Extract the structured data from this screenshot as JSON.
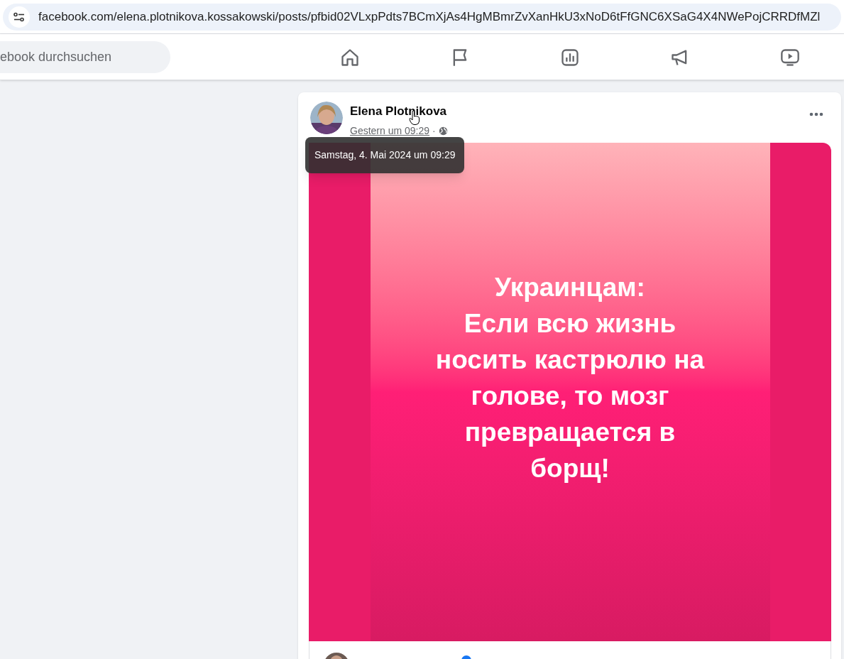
{
  "browser": {
    "url": "facebook.com/elena.plotnikova.kossakowski/posts/pfbid02VLxpPdts7BCmXjAs4HgMBmrZvXanHkU3xNoD6tFfGNC6XSaG4X4NWePojCRRDfMZl"
  },
  "top_bar": {
    "search": {
      "placeholder": "ebook durchsuchen"
    },
    "nav": [
      {
        "kind": "home",
        "selected": false
      },
      {
        "kind": "flag",
        "selected": false
      },
      {
        "kind": "chart",
        "selected": false
      },
      {
        "kind": "megaphone",
        "selected": false
      },
      {
        "kind": "video",
        "selected": false
      }
    ]
  },
  "post": {
    "author": "Elena Plotnikova",
    "time": "Gestern um 09:29",
    "separator": "·",
    "tooltip": "Samstag, 4. Mai 2024 um 09:29",
    "image_text": [
      "Украинцам:",
      "Если всю жизнь",
      "носить кастрюлю на",
      "голове, то мозг",
      "превращается в",
      "борщ!"
    ]
  }
}
